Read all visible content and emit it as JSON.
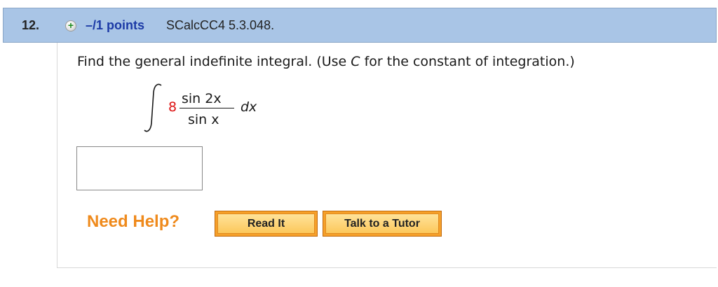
{
  "question": {
    "number": "12.",
    "points_label": "–/1 points",
    "source": "SCalcCC4 5.3.048.",
    "prompt_before": "Find the general indefinite integral. (Use ",
    "prompt_var": "C",
    "prompt_after": " for the constant of integration.)"
  },
  "integral": {
    "coefficient": "8",
    "numerator": "sin 2x",
    "denominator": "sin x",
    "differential": "dx"
  },
  "answer": {
    "value": ""
  },
  "help": {
    "label": "Need Help?",
    "read_it": "Read It",
    "talk_to_tutor": "Talk to a Tutor"
  },
  "colors": {
    "header_bg": "#a9c5e6",
    "points": "#1c3aa6",
    "need_help": "#ef8a1c",
    "coefficient": "#dd1111"
  }
}
